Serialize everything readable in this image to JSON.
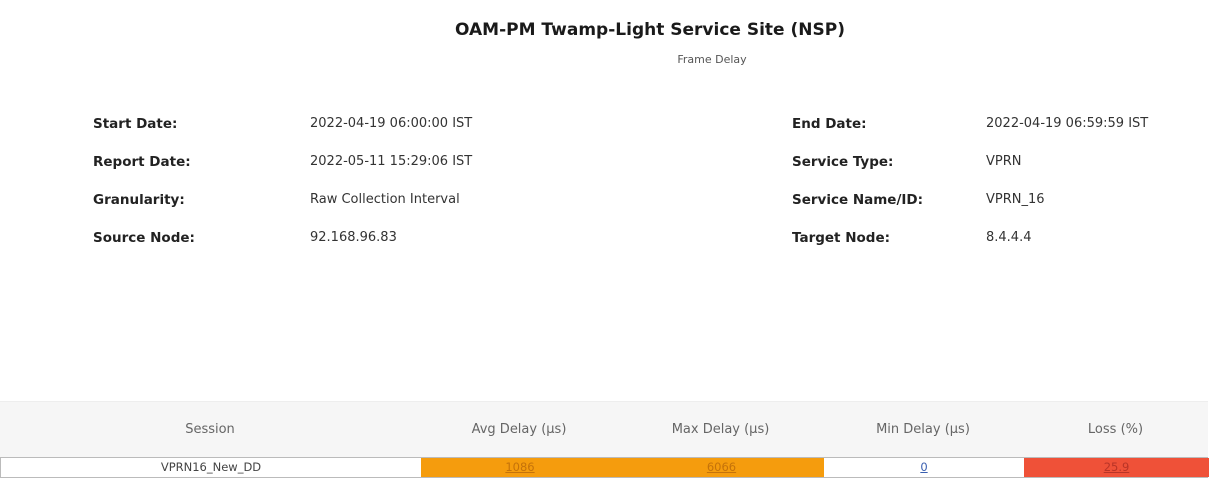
{
  "report": {
    "title": "OAM-PM Twamp-Light Service Site (NSP)",
    "subtitle": "Frame Delay"
  },
  "meta": {
    "rows": [
      {
        "left_label": "Start Date:",
        "left_value": "2022-04-19 06:00:00 IST",
        "right_label": "End Date:",
        "right_value": "2022-04-19 06:59:59 IST"
      },
      {
        "left_label": "Report Date:",
        "left_value": "2022-05-11 15:29:06 IST",
        "right_label": "Service Type:",
        "right_value": "VPRN"
      },
      {
        "left_label": "Granularity:",
        "left_value": "Raw Collection Interval",
        "right_label": "Service Name/ID:",
        "right_value": "VPRN_16"
      },
      {
        "left_label": "Source Node:",
        "left_value": "92.168.96.83",
        "right_label": "Target Node:",
        "right_value": "8.4.4.4"
      }
    ]
  },
  "table": {
    "headers": [
      "Session",
      "Avg Delay (µs)",
      "Max Delay (µs)",
      "Min Delay (µs)",
      "Loss (%)"
    ],
    "rows": [
      {
        "session": "VPRN16_New_DD",
        "avg_delay": "1086",
        "max_delay": "6066",
        "min_delay": "0",
        "loss": "25.9"
      }
    ]
  },
  "colors": {
    "warning": "#f59c0d",
    "critical": "#ef5138",
    "header_bg": "#f6f6f6"
  }
}
